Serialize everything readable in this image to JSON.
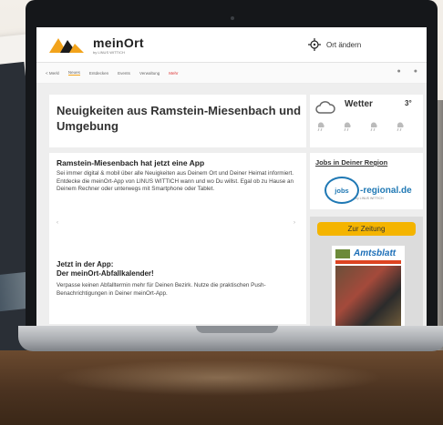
{
  "colors": {
    "accent": "#f4b400",
    "brand_blue": "#1f78b4",
    "nav_active": "#f2a31b"
  },
  "header": {
    "brand": "meinOrt",
    "brand_sub": "by LINUS WITTICH",
    "location_icon": "crosshair-icon",
    "location_label": "Ort ändern"
  },
  "nav": {
    "items": [
      "< Merkl",
      "Neues",
      "Entdecken",
      "Events",
      "Verwaltung",
      "Mehr"
    ],
    "icons": [
      "search-icon",
      "menu-icon"
    ]
  },
  "headline": {
    "title": "Neuigkeiten aus Ramstein-Miesenbach und Umgebung"
  },
  "weather": {
    "title": "Wetter",
    "temp": "3°",
    "icons": [
      "cloud-icon",
      "rain-icon",
      "rain-icon",
      "rain-icon",
      "rain-icon"
    ]
  },
  "app_promo": {
    "title": "Ramstein-Miesenbach hat jetzt eine App",
    "text": "Sei immer digital & mobil über alle Neuigkeiten aus Deinem Ort und Deiner Heimat informiert. Entdecke die meinOrt-App von LINUS WITTICH wann und wo Du willst. Egal ob zu Hause an Deinem Rechner oder unterwegs mit Smartphone oder Tablet.",
    "title2": "Jetzt in der App:\nDer meinOrt-Abfallkalender!",
    "text2": "Verpasse keinen Abfalltermin mehr für Deinen Bezirk. Nutze die praktischen Push-Benachrichtigungen in Deiner meinOrt-App."
  },
  "jobs": {
    "title": "Jobs in Deiner Region",
    "logo_circle": "jobs",
    "logo_word": "-regional.de",
    "logo_sub": "by LINUS WITTICH"
  },
  "zeitung": {
    "button": "Zur Zeitung",
    "paper_title": "Amtsblatt"
  }
}
